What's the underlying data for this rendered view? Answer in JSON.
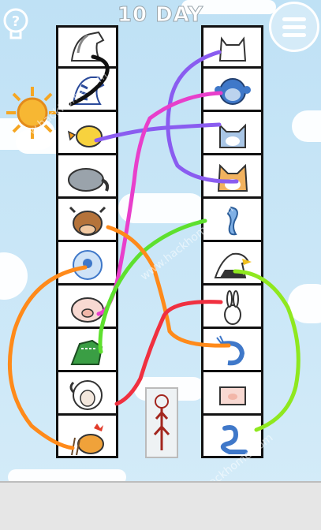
{
  "header": {
    "level_title": "10 DAY"
  },
  "left_column": [
    "horse",
    "zebra",
    "chick",
    "elephant",
    "cow",
    "peacock",
    "pig",
    "crocodile",
    "sheep",
    "rooster"
  ],
  "right_column": [
    "cat",
    "monkey",
    "dog",
    "corgi",
    "seahorse",
    "eagle",
    "rabbit",
    "shrimp",
    "box-pig",
    "snake"
  ],
  "watermark": "www.hackhome.com",
  "colors": {
    "sky": "#bfe1f5",
    "black_line": "#111111",
    "purple_line": "#8a5cf0",
    "pink_line": "#e83fcb",
    "green_line": "#5ee02e",
    "orange_line": "#ff8a1a",
    "red_line": "#f03040",
    "lime_line": "#8fe81f"
  }
}
